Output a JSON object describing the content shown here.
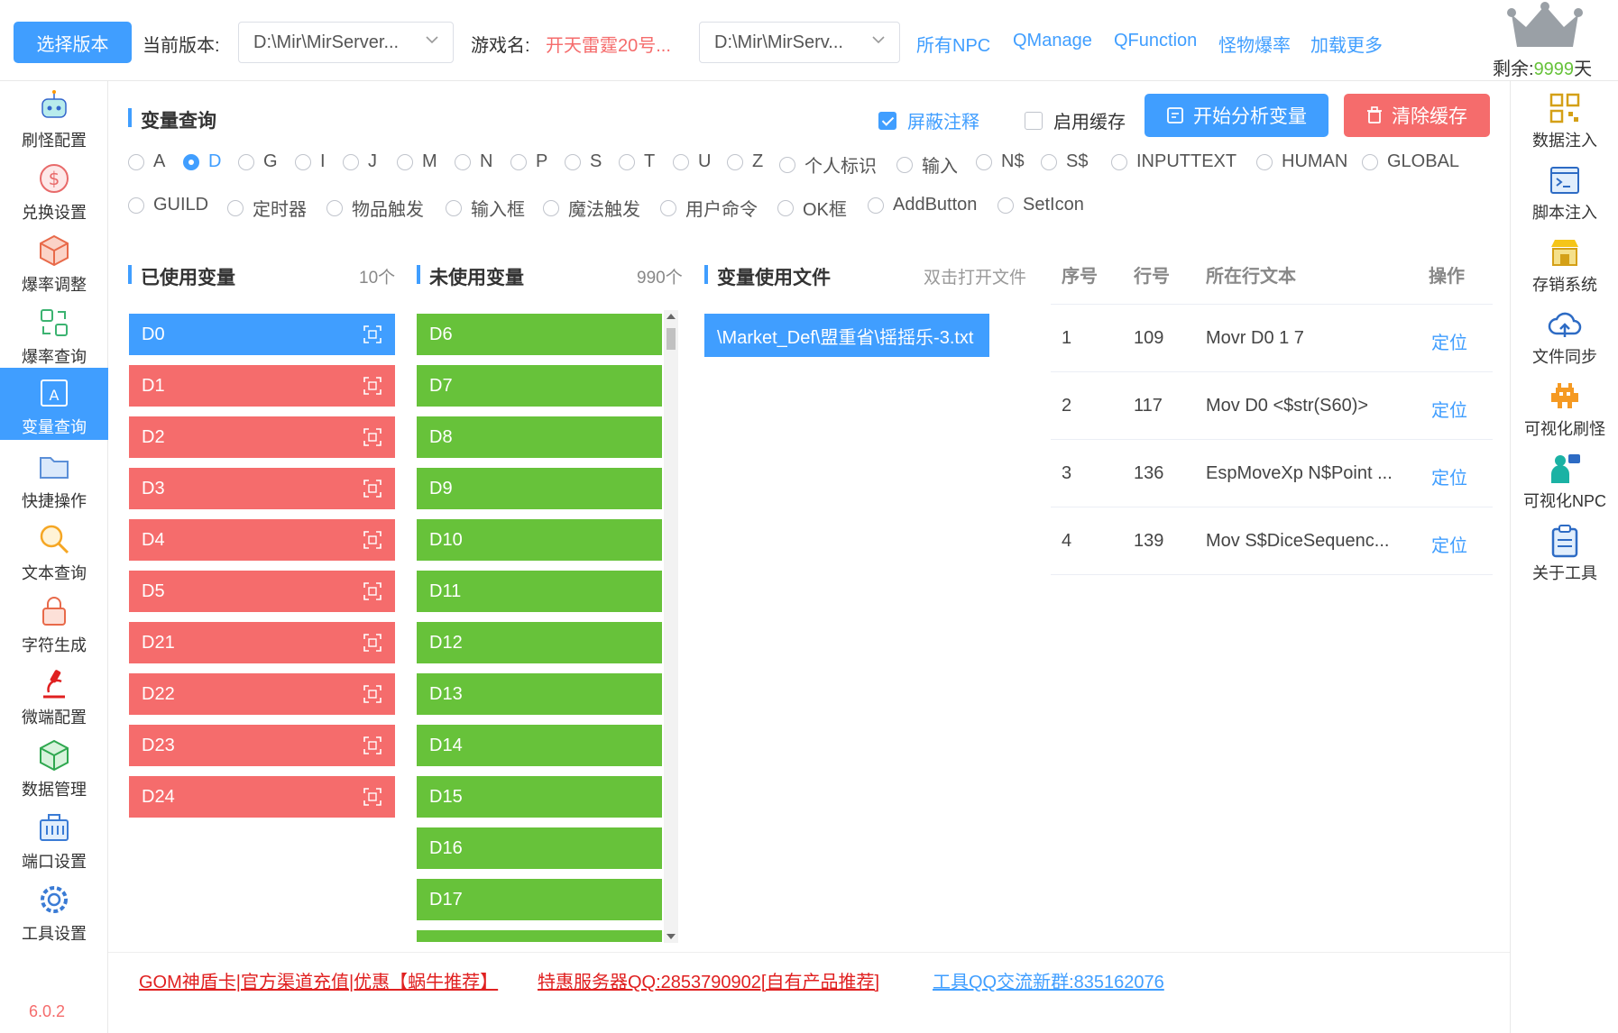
{
  "topbar": {
    "select_version_button": "选择版本",
    "current_version_label": "当前版本:",
    "version_path": "D:\\Mir\\MirServer...",
    "game_name_label": "游戏名:",
    "game_name_value": "开天雷霆20号...",
    "server_path": "D:\\Mir\\MirServ...",
    "links": [
      "所有NPC",
      "QManage",
      "QFunction",
      "怪物爆率",
      "加载更多"
    ],
    "remaining_label": "剩余:",
    "remaining_days": "9999",
    "remaining_unit": "天"
  },
  "left_nav": {
    "items": [
      {
        "label": "刷怪配置",
        "icon": "robot-icon"
      },
      {
        "label": "兑换设置",
        "icon": "dollar-icon"
      },
      {
        "label": "爆率调整",
        "icon": "cube-icon"
      },
      {
        "label": "爆率查询",
        "icon": "refresh-icon"
      },
      {
        "label": "变量查询",
        "icon": "variable-icon",
        "active": true
      },
      {
        "label": "快捷操作",
        "icon": "folder-icon"
      },
      {
        "label": "文本查询",
        "icon": "search-icon"
      },
      {
        "label": "字符生成",
        "icon": "lock-icon"
      },
      {
        "label": "微端配置",
        "icon": "microscope-icon"
      },
      {
        "label": "数据管理",
        "icon": "box-icon"
      },
      {
        "label": "端口设置",
        "icon": "port-icon"
      },
      {
        "label": "工具设置",
        "icon": "gear-icon"
      }
    ],
    "version": "6.0.2"
  },
  "right_nav": {
    "items": [
      {
        "label": "数据注入",
        "icon": "qrcode-icon"
      },
      {
        "label": "脚本注入",
        "icon": "terminal-icon"
      },
      {
        "label": "存销系统",
        "icon": "store-icon"
      },
      {
        "label": "文件同步",
        "icon": "cloud-upload-icon"
      },
      {
        "label": "可视化刷怪",
        "icon": "invader-icon"
      },
      {
        "label": "可视化NPC",
        "icon": "person-icon"
      },
      {
        "label": "关于工具",
        "icon": "clipboard-icon"
      }
    ]
  },
  "main": {
    "title": "变量查询",
    "hide_comments": "屏蔽注释",
    "enable_cache": "启用缓存",
    "analyze_button": "开始分析变量",
    "clear_cache_button": "清除缓存",
    "radios_row1": [
      "A",
      "D",
      "G",
      "I",
      "J",
      "M",
      "N",
      "P",
      "S",
      "T",
      "U",
      "Z",
      "个人标识",
      "输入",
      "N$",
      "S$",
      "INPUTTEXT",
      "HUMAN",
      "GLOBAL"
    ],
    "radios_row2": [
      "GUILD",
      "定时器",
      "物品触发",
      "输入框",
      "魔法触发",
      "用户命令",
      "OK框",
      "AddButton",
      "SetIcon"
    ],
    "selected_radio": "D",
    "used_title": "已使用变量",
    "used_count": "10个",
    "used_vars": [
      "D0",
      "D1",
      "D2",
      "D3",
      "D4",
      "D5",
      "D21",
      "D22",
      "D23",
      "D24"
    ],
    "unused_title": "未使用变量",
    "unused_count": "990个",
    "unused_vars": [
      "D6",
      "D7",
      "D8",
      "D9",
      "D10",
      "D11",
      "D12",
      "D13",
      "D14",
      "D15",
      "D16",
      "D17"
    ],
    "files_title": "变量使用文件",
    "files_hint": "双击打开文件",
    "files": [
      "\\Market_Def\\盟重省\\摇摇乐-3.txt"
    ],
    "table": {
      "headers": [
        "序号",
        "行号",
        "所在行文本",
        "操作"
      ],
      "rows": [
        {
          "idx": "1",
          "line": "109",
          "text": "Movr D0 1 7",
          "action": "定位"
        },
        {
          "idx": "2",
          "line": "117",
          "text": "Mov D0 <$str(S60)>",
          "action": "定位"
        },
        {
          "idx": "3",
          "line": "136",
          "text": "EspMoveXp N$Point ...",
          "action": "定位"
        },
        {
          "idx": "4",
          "line": "139",
          "text": "Mov S$DiceSequenc...",
          "action": "定位"
        }
      ]
    }
  },
  "footer": {
    "links": [
      {
        "text": "GOM神盾卡|官方渠道充值|优惠【蜗牛推荐】",
        "color": "#e02020"
      },
      {
        "text": "特惠服务器QQ:2853790902[自有产品推荐]",
        "color": "#e02020"
      },
      {
        "text": "工具QQ交流新群:835162076",
        "color": "#409eff"
      }
    ]
  }
}
